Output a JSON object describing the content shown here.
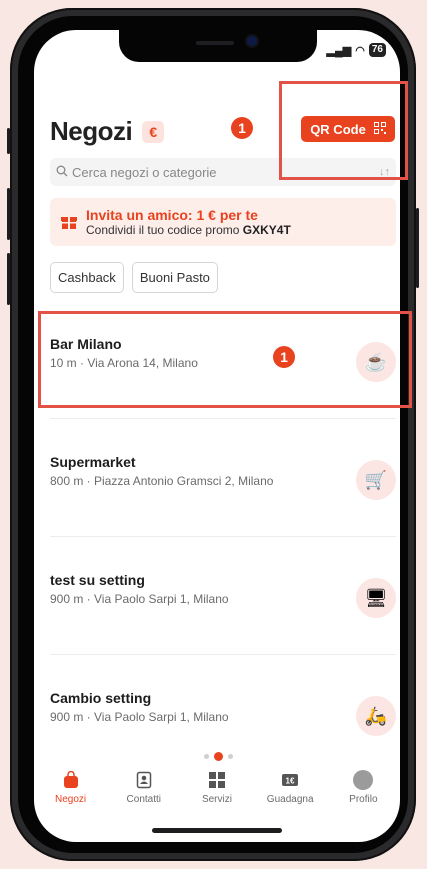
{
  "status": {
    "battery": "76",
    "signal_icon": "signal-icon",
    "wifi_icon": "wifi-icon"
  },
  "header": {
    "title": "Negozi",
    "currency_badge": "€",
    "qr_label": "QR Code"
  },
  "search": {
    "placeholder": "Cerca negozi o categorie"
  },
  "promo": {
    "title": "Invita un amico: 1 € per te",
    "subtitle_prefix": "Condividi il tuo codice promo",
    "code": "GXKY4T"
  },
  "chips": [
    "Cashback",
    "Buoni Pasto"
  ],
  "stores": [
    {
      "name": "Bar Milano",
      "address": "10 m · Via Arona 14, Milano",
      "icon": "coffee-icon"
    },
    {
      "name": "Supermarket",
      "address": "800 m · Piazza Antonio Gramsci 2, Milano",
      "icon": "cart-icon"
    },
    {
      "name": "test su setting",
      "address": "900 m · Via Paolo Sarpi 1, Milano",
      "icon": "register-icon"
    },
    {
      "name": "Cambio setting",
      "address": "900 m · Via Paolo Sarpi 1, Milano",
      "icon": "scooter-icon"
    }
  ],
  "tabs": [
    {
      "label": "Negozi",
      "icon": "shop-bag-icon",
      "active": true
    },
    {
      "label": "Contatti",
      "icon": "contacts-icon",
      "active": false
    },
    {
      "label": "Servizi",
      "icon": "grid-icon",
      "active": false
    },
    {
      "label": "Guadagna",
      "icon": "coupon-icon",
      "active": false
    },
    {
      "label": "Profilo",
      "icon": "avatar-icon",
      "active": false
    }
  ],
  "annotations": {
    "marker_1": "1",
    "marker_2": "1"
  },
  "colors": {
    "accent": "#e8421f",
    "highlight": "#e35247"
  }
}
